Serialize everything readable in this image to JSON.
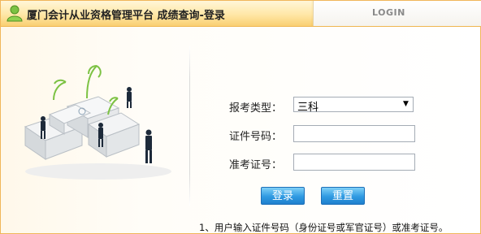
{
  "header": {
    "title": "厦门会计从业资格管理平台 成绩查询-登录",
    "login_tab": "LOGIN"
  },
  "form": {
    "exam_type_label": "报考类型：",
    "exam_type_value": "三科",
    "id_number_label": "证件号码：",
    "id_number_value": "",
    "exam_number_label": "准考证号：",
    "exam_number_value": "",
    "login_button": "登录",
    "reset_button": "重置"
  },
  "note": "1、用户输入证件号码（身份证号或军官证号）或准考证号。",
  "colors": {
    "accent_orange": "#f7c968",
    "button_blue": "#2f9ae2",
    "border": "#f0b65a"
  },
  "icons": {
    "header": "user-icon",
    "select": "chevron-down-icon"
  }
}
